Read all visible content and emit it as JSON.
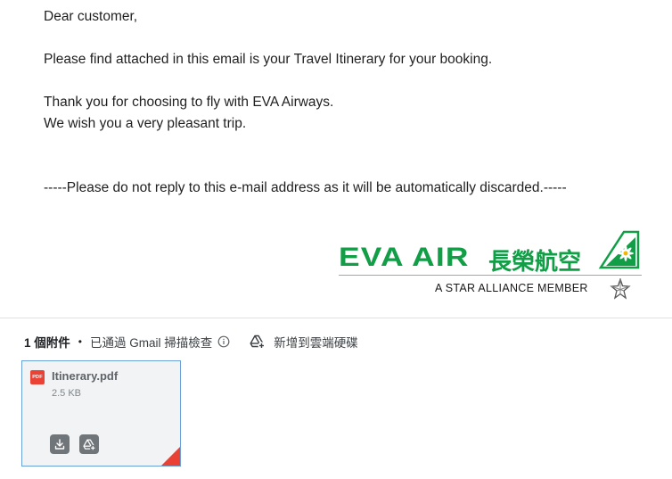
{
  "email": {
    "greeting": "Dear customer,",
    "line_attachment": "Please find attached in this email is your Travel Itinerary for your booking.",
    "line_thanks": "Thank you for choosing to fly with EVA Airways.",
    "line_wish": "We wish you a very pleasant trip.",
    "line_noreply": "-----Please do not reply to this e-mail address as it will be automatically discarded.-----"
  },
  "logo": {
    "wordmark": "EVA AIR",
    "cjk_name": "長榮航空",
    "tagline": "A STAR ALLIANCE MEMBER",
    "brand_color": "#129d47"
  },
  "attachments": {
    "count_label": "1 個附件",
    "separator": "•",
    "scan_label": "已通過 Gmail 掃描檢查",
    "drive_label": "新增到雲端硬碟",
    "files": [
      {
        "badge": "PDF",
        "name": "Itinerary.pdf",
        "size": "2.5 KB"
      }
    ]
  }
}
